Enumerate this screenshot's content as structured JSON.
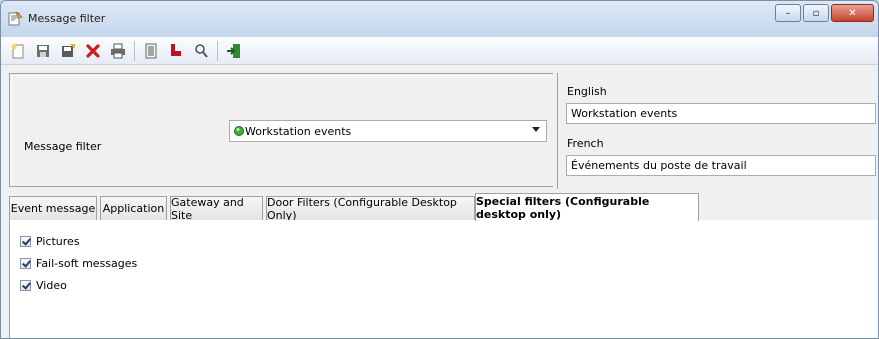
{
  "window": {
    "title": "Message filter",
    "controls": {
      "minimize": "–",
      "maximize": "▫",
      "close": "✕"
    }
  },
  "toolbar": {
    "icons": [
      "new-icon",
      "save-icon",
      "save-as-icon",
      "delete-icon",
      "print-icon",
      "list-icon",
      "hierarchy-icon",
      "search-icon",
      "exit-icon"
    ]
  },
  "filter": {
    "label": "Message filter",
    "selected": "Workstation events",
    "status_color": "#3bb33b"
  },
  "languages": {
    "english_label": "English",
    "english_value": "Workstation events",
    "french_label": "French",
    "french_value": "Événements du poste de travail"
  },
  "tabs": [
    {
      "label": "Event message"
    },
    {
      "label": "Application"
    },
    {
      "label": "Gateway and Site"
    },
    {
      "label": "Door Filters (Configurable Desktop Only)"
    },
    {
      "label": "Special filters (Configurable desktop only)"
    }
  ],
  "special_filters": [
    {
      "label": "Pictures",
      "checked": true
    },
    {
      "label": "Fail-soft messages",
      "checked": true
    },
    {
      "label": "Video",
      "checked": true
    }
  ]
}
